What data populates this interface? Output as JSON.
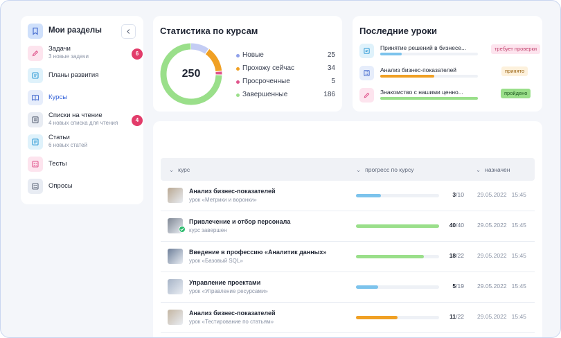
{
  "colors": {
    "accent": "#2f5fd8",
    "badge": "#e23c6a",
    "blue": "#7cc3ec",
    "orange": "#f0a024",
    "pink": "#e0558c",
    "green": "#9adf8a",
    "lavender": "#c4cdf4"
  },
  "sidebar": {
    "title": "Мои разделы",
    "collapse_icon": "chevron-left-icon",
    "items": [
      {
        "label": "Задачи",
        "sub": "3 новые задачи",
        "badge": "6",
        "icon": "edit-icon",
        "icon_bg": "#fde4ee",
        "icon_fg": "#e0558c"
      },
      {
        "label": "Планы развития",
        "sub": "",
        "badge": "",
        "icon": "plan-icon",
        "icon_bg": "#dff2fb",
        "icon_fg": "#2f9ad6"
      },
      {
        "label": "Курсы",
        "sub": "",
        "badge": "",
        "icon": "book-icon",
        "icon_bg": "#e6edfb",
        "icon_fg": "#4a6fd0",
        "active": true
      },
      {
        "label": "Списки на чтение",
        "sub": "4 новых списка для чтения",
        "badge": "4",
        "icon": "list-icon",
        "icon_bg": "#e8ecf3",
        "icon_fg": "#5b6477"
      },
      {
        "label": "Статьи",
        "sub": "6 новых статей",
        "badge": "",
        "icon": "article-icon",
        "icon_bg": "#dff2fb",
        "icon_fg": "#2f9ad6"
      },
      {
        "label": "Тесты",
        "sub": "",
        "badge": "",
        "icon": "test-icon",
        "icon_bg": "#fde4ee",
        "icon_fg": "#e0558c"
      },
      {
        "label": "Опросы",
        "sub": "",
        "badge": "",
        "icon": "survey-icon",
        "icon_bg": "#e8ecf3",
        "icon_fg": "#5b6477"
      }
    ]
  },
  "stats": {
    "title": "Статистика по курсам",
    "total": "250",
    "segments": [
      {
        "name": "Новые",
        "value": 25,
        "color": "#c4cdf4",
        "dot": "#8fa0ea"
      },
      {
        "name": "Прохожу сейчас",
        "value": 34,
        "color": "#f0a024",
        "dot": "#f0a024"
      },
      {
        "name": "Просроченные",
        "value": 5,
        "color": "#e0558c",
        "dot": "#e0558c"
      },
      {
        "name": "Завершенные",
        "value": 186,
        "color": "#9adf8a",
        "dot": "#9adf8a"
      }
    ]
  },
  "recent": {
    "title": "Последние уроки",
    "items": [
      {
        "title": "Принятие решений в бизнесе...",
        "progress": 0.22,
        "bar": "#7cc3ec",
        "status": "требует проверки",
        "status_bg": "#fde4ee",
        "status_fg": "#c2456f",
        "icon": "plan-icon",
        "icon_bg": "#dff2fb",
        "icon_fg": "#2f9ad6"
      },
      {
        "title": "Анализ бизнес-показателей",
        "progress": 0.55,
        "bar": "#f0a024",
        "status": "принято",
        "status_bg": "#fdf1dc",
        "status_fg": "#9a6312",
        "icon": "checklist-icon",
        "icon_bg": "#e6edfb",
        "icon_fg": "#4a6fd0"
      },
      {
        "title": "Знакомство с нашими ценно...",
        "progress": 1.0,
        "bar": "#9adf8a",
        "status": "пройдено",
        "status_bg": "#9adf8a",
        "status_fg": "#1f5a22",
        "icon": "edit-icon",
        "icon_bg": "#fde4ee",
        "icon_fg": "#e0558c"
      }
    ]
  },
  "table": {
    "columns": [
      "курс",
      "прогресс по курсу",
      "назначен"
    ],
    "rows": [
      {
        "name": "Анализ бизнес-показателей",
        "sub": "урок «Метрики и воронки»",
        "done": 3,
        "total": 10,
        "bar": "#7cc3ec",
        "date": "29.05.2022",
        "time": "15:45",
        "thumb": "#b9a892",
        "completed": false
      },
      {
        "name": "Привлечение и отбор персонала",
        "sub": "курс завершен",
        "done": 40,
        "total": 40,
        "bar": "#9adf8a",
        "date": "29.05.2022",
        "time": "15:45",
        "thumb": "#7f8794",
        "completed": true
      },
      {
        "name": "Введение в профессию «Аналитик данных»",
        "sub": "урок «Базовый SQL»",
        "done": 18,
        "total": 22,
        "bar": "#9adf8a",
        "date": "29.05.2022",
        "time": "15:45",
        "thumb": "#6e7f9a",
        "completed": false
      },
      {
        "name": "Управление проектами",
        "sub": "урок «Управление ресурсами»",
        "done": 5,
        "total": 19,
        "bar": "#7cc3ec",
        "date": "29.05.2022",
        "time": "15:45",
        "thumb": "#a7b4c7",
        "completed": false
      },
      {
        "name": "Анализ бизнес-показателей",
        "sub": "урок «Тестирование по статьям»",
        "done": 11,
        "total": 22,
        "bar": "#f0a024",
        "date": "29.05.2022",
        "time": "15:45",
        "thumb": "#c4b6a3",
        "completed": false
      }
    ]
  }
}
